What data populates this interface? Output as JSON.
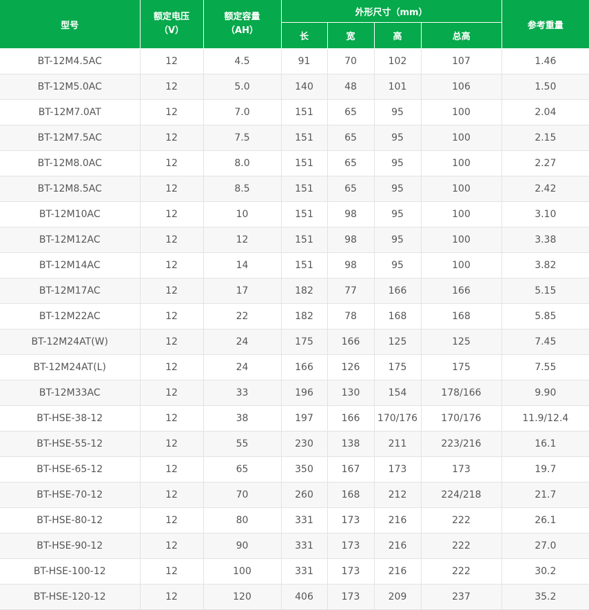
{
  "header": {
    "model": "型号",
    "voltage": "额定电压",
    "voltage_unit": "（V）",
    "capacity": "额定容量",
    "capacity_unit": "（AH）",
    "dimensions": "外形尺寸（mm）",
    "length": "长",
    "width": "宽",
    "height": "高",
    "total_height": "总高",
    "weight": "参考重量"
  },
  "rows": [
    [
      "BT-12M4.5AC",
      "12",
      "4.5",
      "91",
      "70",
      "102",
      "107",
      "1.46"
    ],
    [
      "BT-12M5.0AC",
      "12",
      "5.0",
      "140",
      "48",
      "101",
      "106",
      "1.50"
    ],
    [
      "BT-12M7.0AT",
      "12",
      "7.0",
      "151",
      "65",
      "95",
      "100",
      "2.04"
    ],
    [
      "BT-12M7.5AC",
      "12",
      "7.5",
      "151",
      "65",
      "95",
      "100",
      "2.15"
    ],
    [
      "BT-12M8.0AC",
      "12",
      "8.0",
      "151",
      "65",
      "95",
      "100",
      "2.27"
    ],
    [
      "BT-12M8.5AC",
      "12",
      "8.5",
      "151",
      "65",
      "95",
      "100",
      "2.42"
    ],
    [
      "BT-12M10AC",
      "12",
      "10",
      "151",
      "98",
      "95",
      "100",
      "3.10"
    ],
    [
      "BT-12M12AC",
      "12",
      "12",
      "151",
      "98",
      "95",
      "100",
      "3.38"
    ],
    [
      "BT-12M14AC",
      "12",
      "14",
      "151",
      "98",
      "95",
      "100",
      "3.82"
    ],
    [
      "BT-12M17AC",
      "12",
      "17",
      "182",
      "77",
      "166",
      "166",
      "5.15"
    ],
    [
      "BT-12M22AC",
      "12",
      "22",
      "182",
      "78",
      "168",
      "168",
      "5.85"
    ],
    [
      "BT-12M24AT(W)",
      "12",
      "24",
      "175",
      "166",
      "125",
      "125",
      "7.45"
    ],
    [
      "BT-12M24AT(L)",
      "12",
      "24",
      "166",
      "126",
      "175",
      "175",
      "7.55"
    ],
    [
      "BT-12M33AC",
      "12",
      "33",
      "196",
      "130",
      "154",
      "178/166",
      "9.90"
    ],
    [
      "BT-HSE-38-12",
      "12",
      "38",
      "197",
      "166",
      "170/176",
      "170/176",
      "11.9/12.4"
    ],
    [
      "BT-HSE-55-12",
      "12",
      "55",
      "230",
      "138",
      "211",
      "223/216",
      "16.1"
    ],
    [
      "BT-HSE-65-12",
      "12",
      "65",
      "350",
      "167",
      "173",
      "173",
      "19.7"
    ],
    [
      "BT-HSE-70-12",
      "12",
      "70",
      "260",
      "168",
      "212",
      "224/218",
      "21.7"
    ],
    [
      "BT-HSE-80-12",
      "12",
      "80",
      "331",
      "173",
      "216",
      "222",
      "26.1"
    ],
    [
      "BT-HSE-90-12",
      "12",
      "90",
      "331",
      "173",
      "216",
      "222",
      "27.0"
    ],
    [
      "BT-HSE-100-12",
      "12",
      "100",
      "331",
      "173",
      "216",
      "222",
      "30.2"
    ],
    [
      "BT-HSE-120-12",
      "12",
      "120",
      "406",
      "173",
      "209",
      "237",
      "35.2"
    ]
  ]
}
